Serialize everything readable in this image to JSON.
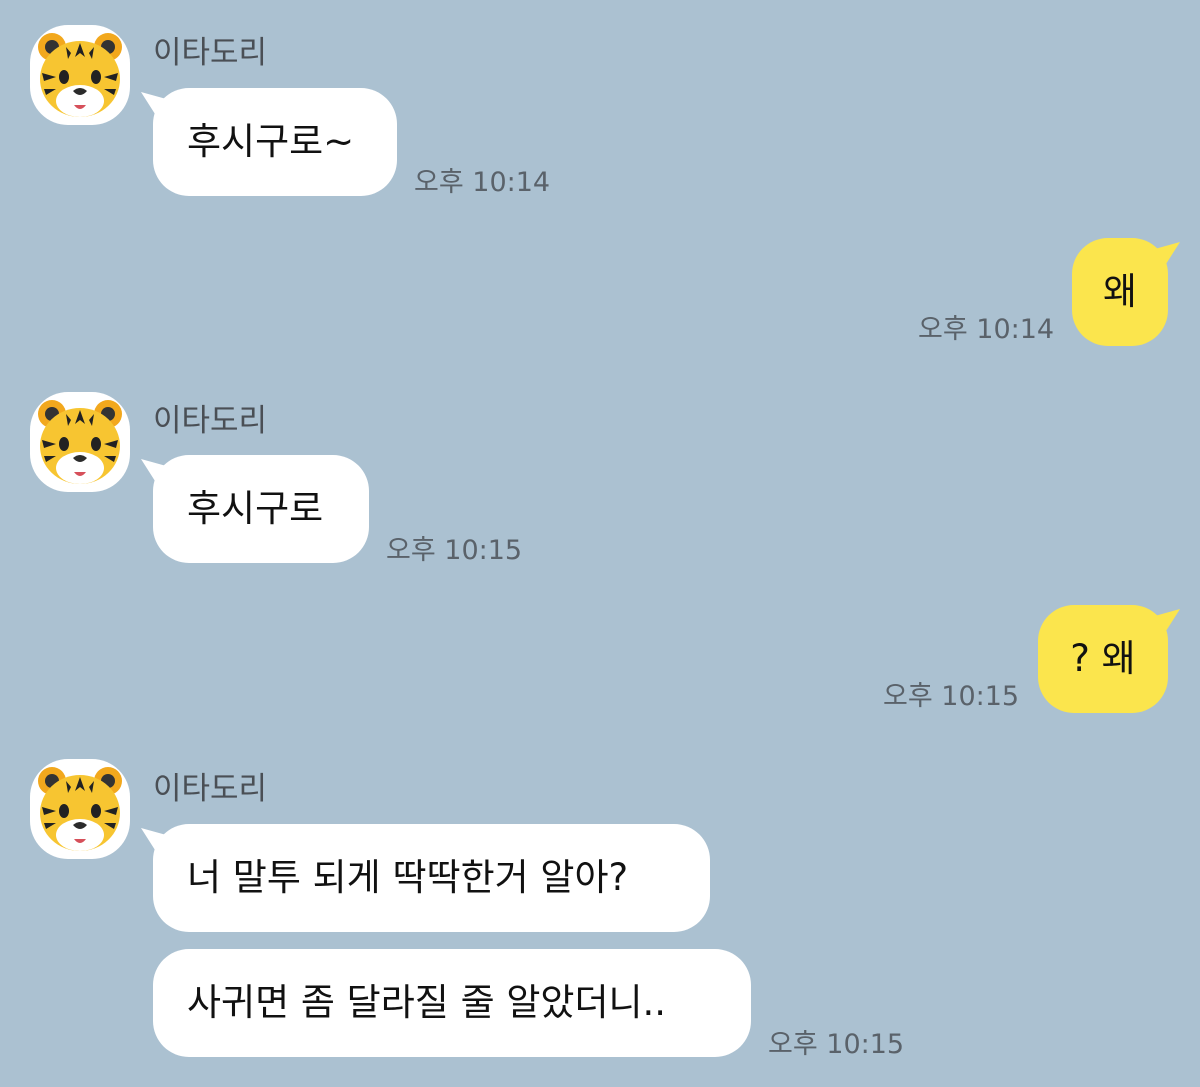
{
  "messages": [
    {
      "sender": "이타도리",
      "text": "후시구로~",
      "time": "오후 10:14"
    },
    {
      "text": "왜",
      "time": "오후 10:14"
    },
    {
      "sender": "이타도리",
      "text": "후시구로",
      "time": "오후 10:15"
    },
    {
      "text": "? 왜",
      "time": "오후 10:15"
    },
    {
      "sender": "이타도리",
      "text": "너 말투 되게 딱딱한거 알아?"
    },
    {
      "text": "사귀면 좀 달라질 줄 알았더니..",
      "time": "오후 10:15"
    }
  ],
  "avatar_icon": "tiger-face-icon",
  "colors": {
    "background": "#abc1d1",
    "incoming_bubble": "#ffffff",
    "outgoing_bubble": "#fbe54d"
  }
}
